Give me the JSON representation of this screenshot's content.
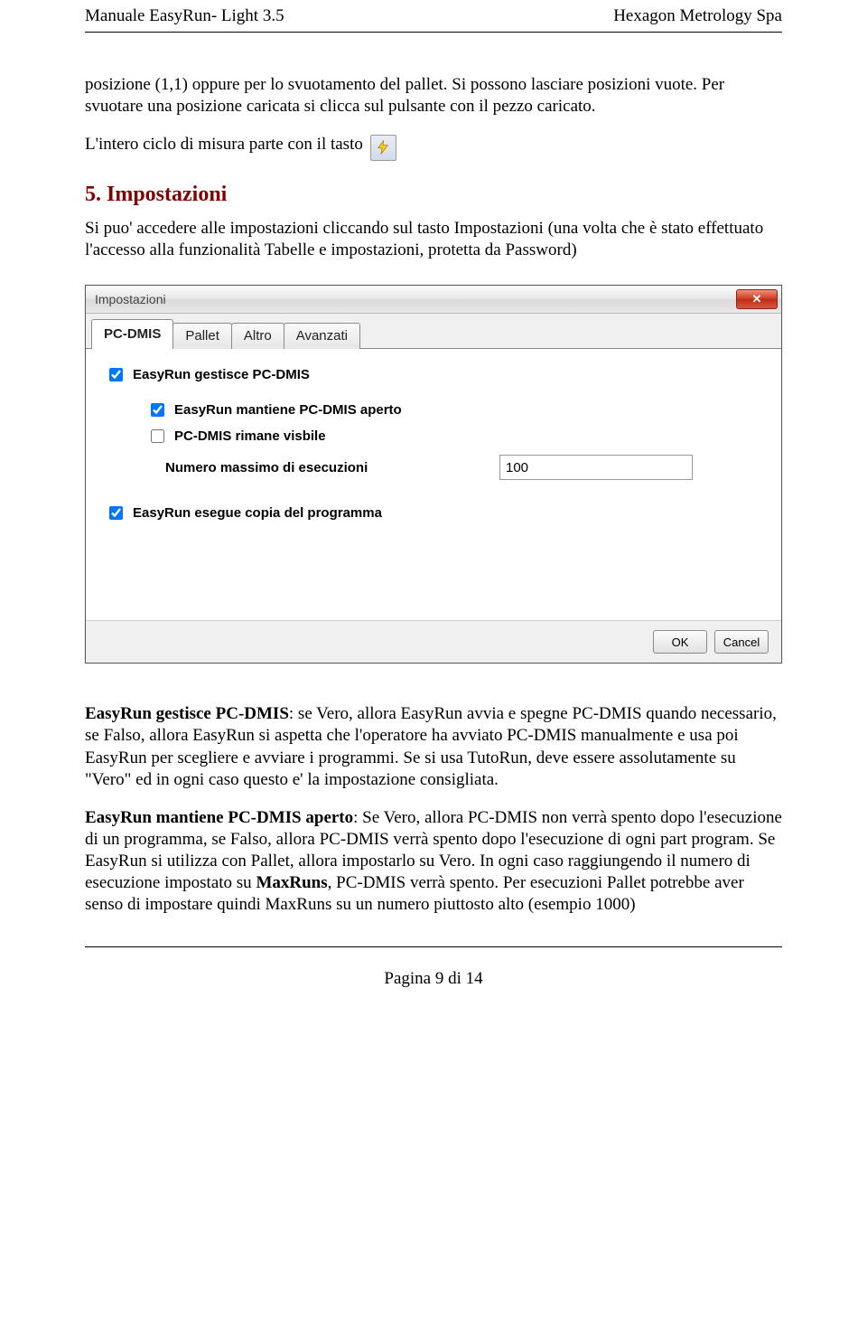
{
  "header": {
    "left": "Manuale EasyRun- Light 3.5",
    "right": "Hexagon Metrology Spa"
  },
  "para1": "posizione (1,1) oppure per lo svuotamento del pallet. Si possono lasciare posizioni vuote. Per svuotare una posizione caricata si clicca sul pulsante con il pezzo caricato.",
  "para2_lead": "L'intero ciclo di misura parte con il tasto",
  "h2": "5. Impostazioni",
  "para3": "Si puo' accedere alle impostazioni cliccando sul tasto Impostazioni (una volta che è stato effettuato l'accesso alla funzionalità Tabelle e impostazioni, protetta da Password)",
  "dialog": {
    "title": "Impostazioni",
    "tabs": [
      "PC-DMIS",
      "Pallet",
      "Altro",
      "Avanzati"
    ],
    "cb_gestisce": "EasyRun gestisce PC-DMIS",
    "cb_mantiene": "EasyRun mantiene PC-DMIS aperto",
    "cb_visibile": "PC-DMIS rimane visbile",
    "lbl_num": "Numero massimo di esecuzioni",
    "val_num": "100",
    "cb_copia": "EasyRun esegue copia del programma",
    "btn_ok": "OK",
    "btn_cancel": "Cancel"
  },
  "p_gestisce_b": "EasyRun gestisce PC-DMIS",
  "p_gestisce_t": ": se Vero, allora EasyRun avvia e spegne PC-DMIS quando necessario, se Falso, allora EasyRun si aspetta che l'operatore ha avviato PC-DMIS manualmente e usa poi EasyRun per scegliere e avviare i programmi. Se si usa TutoRun, deve essere assolutamente su \"Vero\" ed in ogni caso questo e' la impostazione consigliata.",
  "p_mantiene_b": "EasyRun mantiene PC-DMIS aperto",
  "p_mantiene_1": ": Se Vero, allora PC-DMIS non verrà spento dopo l'esecuzione di un programma, se Falso, allora PC-DMIS verrà spento dopo l'esecuzione di ogni part program. Se EasyRun si utilizza con Pallet, allora impostarlo su Vero. In ogni caso raggiungendo il numero di esecuzione impostato su ",
  "p_mantiene_maxruns": "MaxRuns",
  "p_mantiene_2": ", PC-DMIS verrà spento. Per esecuzioni Pallet potrebbe aver senso di impostare quindi MaxRuns su un numero piuttosto alto (esempio 1000)",
  "footer": "Pagina 9 di 14"
}
